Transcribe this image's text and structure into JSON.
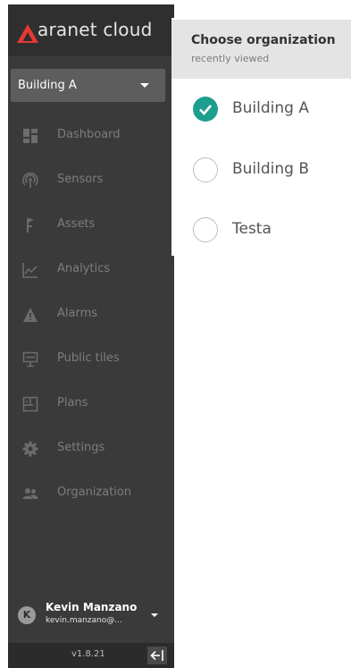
{
  "app": {
    "logo_text": "aranet cloud",
    "accent_color": "#e53935"
  },
  "org_select": {
    "value": "Building A"
  },
  "nav": {
    "items": [
      {
        "id": "dashboard",
        "label": "Dashboard",
        "icon": "dashboard-icon"
      },
      {
        "id": "sensors",
        "label": "Sensors",
        "icon": "sensors-icon"
      },
      {
        "id": "assets",
        "label": "Assets",
        "icon": "assets-icon"
      },
      {
        "id": "analytics",
        "label": "Analytics",
        "icon": "analytics-icon"
      },
      {
        "id": "alarms",
        "label": "Alarms",
        "icon": "alarm-icon"
      },
      {
        "id": "public-tiles",
        "label": "Public tiles",
        "icon": "public-tiles-icon"
      },
      {
        "id": "plans",
        "label": "Plans",
        "icon": "plans-icon"
      },
      {
        "id": "settings",
        "label": "Settings",
        "icon": "gear-icon"
      },
      {
        "id": "organization",
        "label": "Organization",
        "icon": "people-icon"
      }
    ]
  },
  "user": {
    "initial": "K",
    "name": "Kevin Manzano",
    "email": "kevin.manzano@..."
  },
  "footer": {
    "version": "v1.8.21"
  },
  "org_panel": {
    "title": "Choose organization",
    "subtitle": "recently viewed",
    "check_color": "#1e9e8e",
    "options": [
      {
        "name": "Building A",
        "selected": true
      },
      {
        "name": "Building B",
        "selected": false
      },
      {
        "name": "Testa",
        "selected": false
      }
    ]
  }
}
